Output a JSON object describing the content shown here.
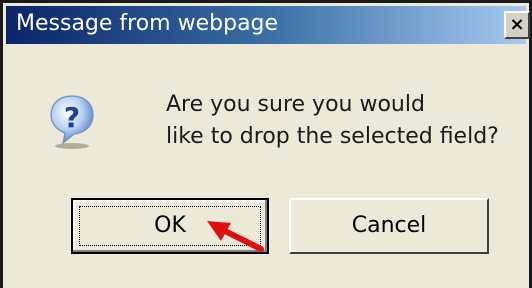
{
  "dialog": {
    "title": "Message from webpage",
    "close_label": "×",
    "icon": "question-icon",
    "message_line1": "Are you sure you would",
    "message_line2": "like to drop the selected field?",
    "ok_label": "OK",
    "cancel_label": "Cancel"
  },
  "colors": {
    "titlebar_start": "#0a246a",
    "titlebar_end": "#a6caf0",
    "dialog_bg": "#ece9d8",
    "annotation_arrow": "#e01010"
  }
}
